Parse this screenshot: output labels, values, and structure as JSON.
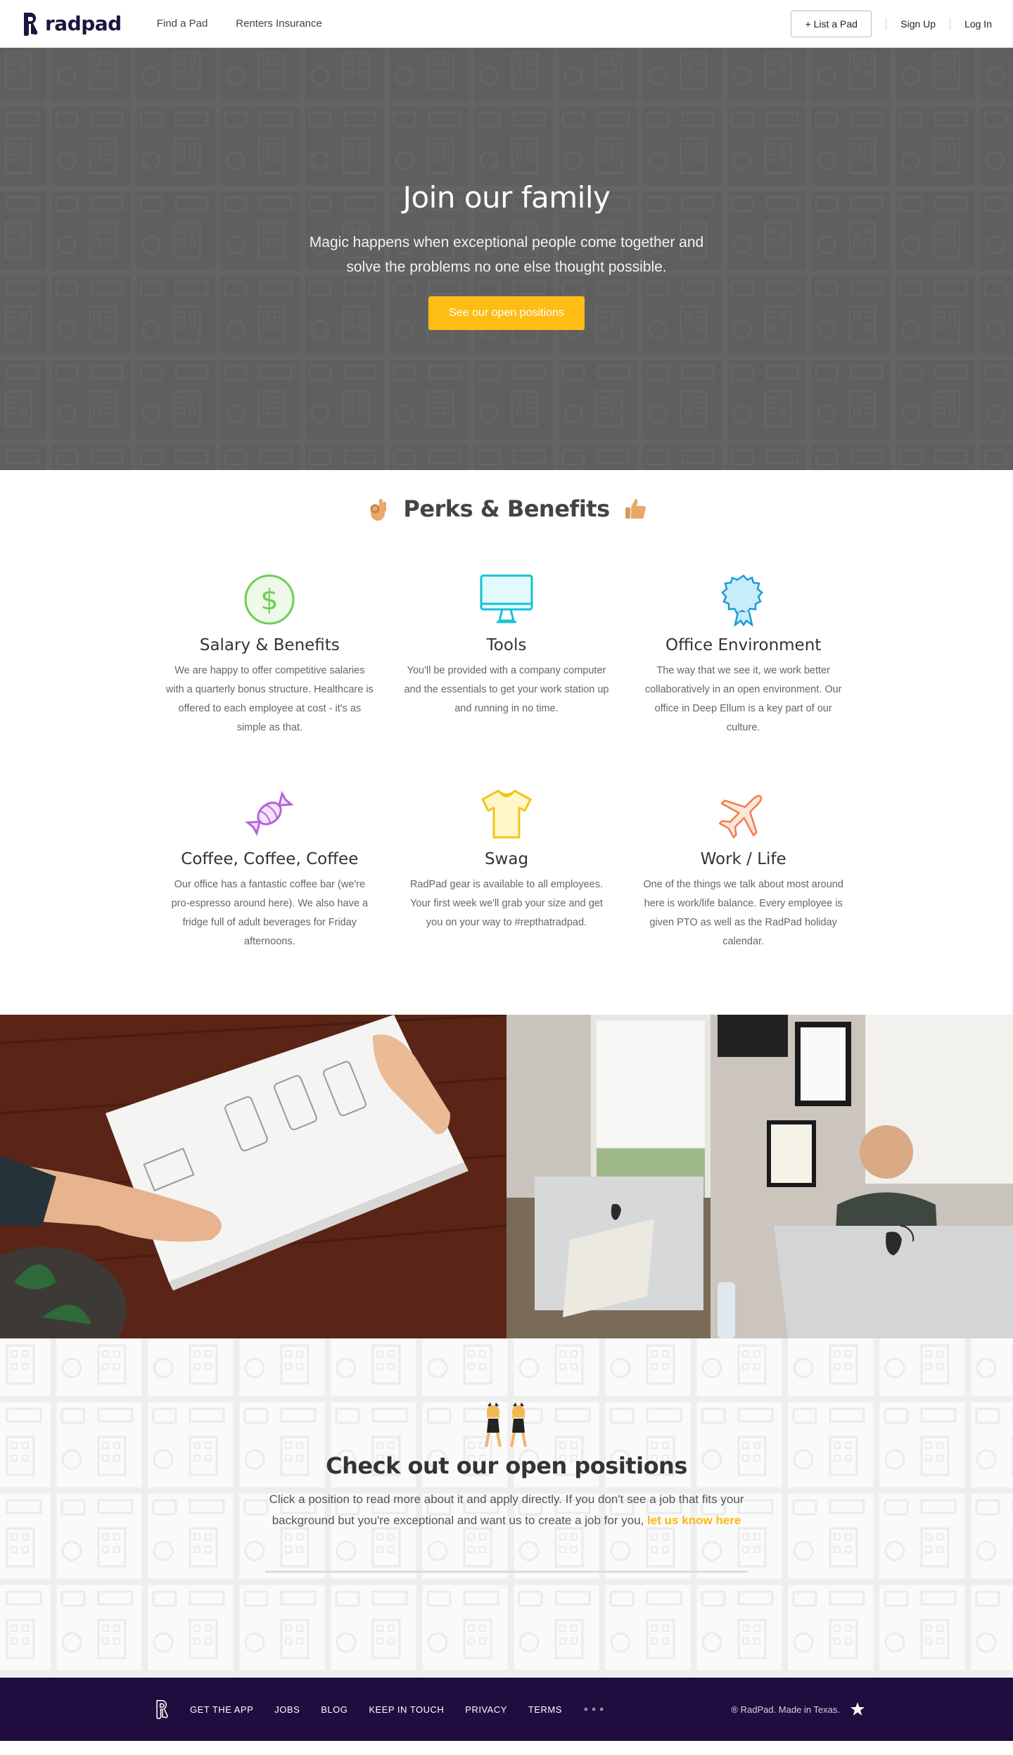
{
  "nav": {
    "logo_text": "radpad",
    "links": [
      "Find a Pad",
      "Renters Insurance"
    ],
    "list_button": "+ List a Pad",
    "sign_up": "Sign Up",
    "log_in": "Log In"
  },
  "hero": {
    "title": "Join our family",
    "subtitle": "Magic happens when exceptional people come together and solve the problems no one else thought possible.",
    "cta": "See our open positions"
  },
  "perks": {
    "title": "Perks & Benefits",
    "items": [
      {
        "icon": "dollar-icon",
        "title": "Salary & Benefits",
        "desc": "We are happy to offer competitive salaries with a quarterly bonus structure. Healthcare is offered to each employee at cost - it's as simple as that."
      },
      {
        "icon": "monitor-icon",
        "title": "Tools",
        "desc": "You'll be provided with a company computer and the essentials to get your work station up and running in no time."
      },
      {
        "icon": "badge-icon",
        "title": "Office Environment",
        "desc": "The way that we see it, we work better collaboratively in an open environment. Our office in Deep Ellum is a key part of our culture."
      },
      {
        "icon": "candy-icon",
        "title": "Coffee, Coffee, Coffee",
        "desc": "Our office has a fantastic coffee bar (we're pro-espresso around here). We also have a fridge full of adult beverages for Friday afternoons."
      },
      {
        "icon": "tshirt-icon",
        "title": "Swag",
        "desc": "RadPad gear is available to all employees. Your first week we'll grab your size and get you on your way to #repthatradpad."
      },
      {
        "icon": "airplane-icon",
        "title": "Work / Life",
        "desc": "One of the things we talk about most around here is work/life balance. Every employee is given PTO as well as the RadPad holiday calendar."
      }
    ]
  },
  "openings": {
    "title": "Check out our open positions",
    "text": "Click a position to read more about it and apply directly. If you don't see a job that fits your background but you're exceptional and want us to create a job for you, ",
    "link": "let us know here"
  },
  "footer": {
    "links": [
      "GET THE APP",
      "JOBS",
      "BLOG",
      "KEEP IN TOUCH",
      "PRIVACY",
      "TERMS"
    ],
    "dots": "∘∘∘",
    "copy": "® RadPad. Made in Texas."
  },
  "colors": {
    "accent": "#fdbd14",
    "footer_bg": "#1f0d3f",
    "hero_bg": "#5f5f5f"
  }
}
